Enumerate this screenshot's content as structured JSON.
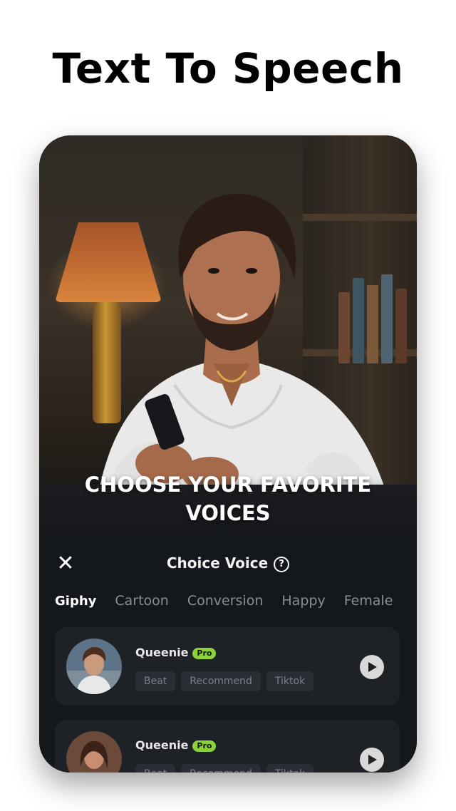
{
  "headline": "Text To Speech",
  "overlay": {
    "line1": "CHOOSE YOUR FAVORITE",
    "line2": "VOICES"
  },
  "panel": {
    "title": "Choice Voice",
    "close_icon": "close-icon",
    "help_icon": "help-icon",
    "tabs": [
      {
        "label": "Giphy",
        "active": true
      },
      {
        "label": "Cartoon",
        "active": false
      },
      {
        "label": "Conversion",
        "active": false
      },
      {
        "label": "Happy",
        "active": false
      },
      {
        "label": "Female",
        "active": false
      }
    ],
    "voices": [
      {
        "name": "Queenie",
        "badge": "Pro",
        "tags": [
          "Beat",
          "Recommend",
          "Tiktok"
        ]
      },
      {
        "name": "Queenie",
        "badge": "Pro",
        "tags": [
          "Beat",
          "Recommend",
          "Tiktok"
        ]
      }
    ]
  },
  "colors": {
    "pro_badge": "#8bd13a",
    "panel_bg": "#14171c",
    "card_bg": "#1e2227"
  }
}
